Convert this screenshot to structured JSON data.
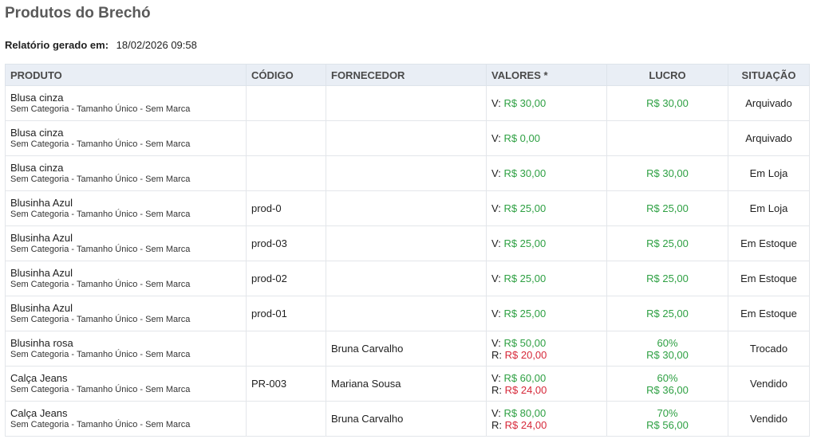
{
  "page": {
    "title": "Produtos do Brechó",
    "report_label": "Relatório gerado em:",
    "report_date": "18/02/2026 09:58"
  },
  "table": {
    "headers": [
      "PRODUTO",
      "CÓDIGO",
      "FORNECEDOR",
      "VALORES *",
      "LUCRO",
      "SITUAÇÃO"
    ],
    "rows": [
      {
        "name": "Blusa cinza",
        "sub": "Sem Categoria - Tamanho Único - Sem Marca",
        "code": "",
        "supplier": "",
        "v_prefix": "V:",
        "v_value": "R$ 30,00",
        "r_prefix": "",
        "r_value": "",
        "profit_pct": "",
        "profit_value": "R$ 30,00",
        "status": "Arquivado"
      },
      {
        "name": "Blusa cinza",
        "sub": "Sem Categoria - Tamanho Único - Sem Marca",
        "code": "",
        "supplier": "",
        "v_prefix": "V:",
        "v_value": "R$ 0,00",
        "r_prefix": "",
        "r_value": "",
        "profit_pct": "",
        "profit_value": "",
        "status": "Arquivado"
      },
      {
        "name": "Blusa cinza",
        "sub": "Sem Categoria - Tamanho Único - Sem Marca",
        "code": "",
        "supplier": "",
        "v_prefix": "V:",
        "v_value": "R$ 30,00",
        "r_prefix": "",
        "r_value": "",
        "profit_pct": "",
        "profit_value": "R$ 30,00",
        "status": "Em Loja"
      },
      {
        "name": "Blusinha Azul",
        "sub": "Sem Categoria - Tamanho Único - Sem Marca",
        "code": "prod-0",
        "supplier": "",
        "v_prefix": "V:",
        "v_value": "R$ 25,00",
        "r_prefix": "",
        "r_value": "",
        "profit_pct": "",
        "profit_value": "R$ 25,00",
        "status": "Em Loja"
      },
      {
        "name": "Blusinha Azul",
        "sub": "Sem Categoria - Tamanho Único - Sem Marca",
        "code": "prod-03",
        "supplier": "",
        "v_prefix": "V:",
        "v_value": "R$ 25,00",
        "r_prefix": "",
        "r_value": "",
        "profit_pct": "",
        "profit_value": "R$ 25,00",
        "status": "Em Estoque"
      },
      {
        "name": "Blusinha Azul",
        "sub": "Sem Categoria - Tamanho Único - Sem Marca",
        "code": "prod-02",
        "supplier": "",
        "v_prefix": "V:",
        "v_value": "R$ 25,00",
        "r_prefix": "",
        "r_value": "",
        "profit_pct": "",
        "profit_value": "R$ 25,00",
        "status": "Em Estoque"
      },
      {
        "name": "Blusinha Azul",
        "sub": "Sem Categoria - Tamanho Único - Sem Marca",
        "code": "prod-01",
        "supplier": "",
        "v_prefix": "V:",
        "v_value": "R$ 25,00",
        "r_prefix": "",
        "r_value": "",
        "profit_pct": "",
        "profit_value": "R$ 25,00",
        "status": "Em Estoque"
      },
      {
        "name": "Blusinha rosa",
        "sub": "Sem Categoria - Tamanho Único - Sem Marca",
        "code": "",
        "supplier": "Bruna Carvalho",
        "v_prefix": "V:",
        "v_value": "R$ 50,00",
        "r_prefix": "R:",
        "r_value": "R$ 20,00",
        "profit_pct": "60%",
        "profit_value": "R$ 30,00",
        "status": "Trocado"
      },
      {
        "name": "Calça Jeans",
        "sub": "Sem Categoria - Tamanho Único - Sem Marca",
        "code": "PR-003",
        "supplier": "Mariana Sousa",
        "v_prefix": "V:",
        "v_value": "R$ 60,00",
        "r_prefix": "R:",
        "r_value": "R$ 24,00",
        "profit_pct": "60%",
        "profit_value": "R$ 36,00",
        "status": "Vendido"
      },
      {
        "name": "Calça Jeans",
        "sub": "Sem Categoria - Tamanho Único - Sem Marca",
        "code": "",
        "supplier": "Bruna Carvalho",
        "v_prefix": "V:",
        "v_value": "R$ 80,00",
        "r_prefix": "R:",
        "r_value": "R$ 24,00",
        "profit_pct": "70%",
        "profit_value": "R$ 56,00",
        "status": "Vendido"
      }
    ]
  },
  "colors": {
    "positive": "#2ea043",
    "negative": "#d62839",
    "header_bg": "#e9eef5"
  }
}
